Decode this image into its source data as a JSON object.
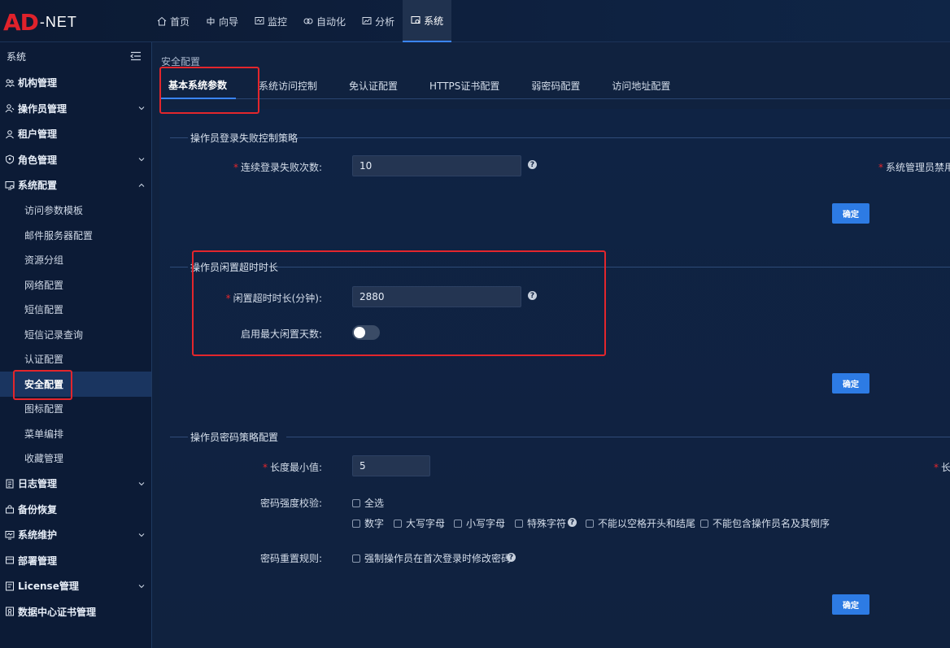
{
  "logo": {
    "mark": "AD",
    "text": "-NET"
  },
  "topnav": [
    {
      "label": "首页",
      "icon": "home-icon"
    },
    {
      "label": "向导",
      "icon": "guide-icon"
    },
    {
      "label": "监控",
      "icon": "monitor-icon"
    },
    {
      "label": "自动化",
      "icon": "automation-icon"
    },
    {
      "label": "分析",
      "icon": "analysis-icon"
    },
    {
      "label": "系统",
      "icon": "system-icon",
      "active": true
    }
  ],
  "sidebar": {
    "title": "系统",
    "items": [
      {
        "label": "机构管理",
        "icon": "organization-icon",
        "expandable": false
      },
      {
        "label": "操作员管理",
        "icon": "operator-icon",
        "expandable": true
      },
      {
        "label": "租户管理",
        "icon": "tenant-icon",
        "expandable": false
      },
      {
        "label": "角色管理",
        "icon": "role-icon",
        "expandable": true
      },
      {
        "label": "系统配置",
        "icon": "system-config-icon",
        "expandable": true,
        "expanded": true,
        "children": [
          "访问参数模板",
          "邮件服务器配置",
          "资源分组",
          "网络配置",
          "短信配置",
          "短信记录查询",
          "认证配置",
          "安全配置",
          "图标配置",
          "菜单编排",
          "收藏管理"
        ],
        "active_child": "安全配置"
      },
      {
        "label": "日志管理",
        "icon": "log-icon",
        "expandable": true
      },
      {
        "label": "备份恢复",
        "icon": "backup-icon",
        "expandable": false
      },
      {
        "label": "系统维护",
        "icon": "maintenance-icon",
        "expandable": true
      },
      {
        "label": "部署管理",
        "icon": "deploy-icon",
        "expandable": false
      },
      {
        "label": "License管理",
        "icon": "license-icon",
        "expandable": true
      },
      {
        "label": "数据中心证书管理",
        "icon": "certificate-icon",
        "expandable": false
      }
    ]
  },
  "main": {
    "breadcrumb": "安全配置",
    "tabs": [
      "基本系统参数",
      "系统访问控制",
      "免认证配置",
      "HTTPS证书配置",
      "弱密码配置",
      "访问地址配置"
    ],
    "active_tab": "基本系统参数",
    "section_login": {
      "legend": "操作员登录失败控制策略",
      "fail_count_label": "连续登录失败次数:",
      "fail_count_value": "10",
      "right_label_partial": "系统管理员禁用",
      "confirm": "确定"
    },
    "section_idle": {
      "legend": "操作员闲置超时时长",
      "timeout_label": "闲置超时时长(分钟):",
      "timeout_value": "2880",
      "max_idle_label": "启用最大闲置天数:",
      "max_idle_enabled": false,
      "confirm": "确定"
    },
    "section_password": {
      "legend": "操作员密码策略配置",
      "min_length_label": "长度最小值:",
      "min_length_value": "5",
      "right_label_partial": "长",
      "strength_label": "密码强度校验:",
      "select_all": "全选",
      "options": [
        "数字",
        "大写字母",
        "小写字母",
        "特殊字符",
        "不能以空格开头和结尾",
        "不能包含操作员名及其倒序"
      ],
      "reset_label": "密码重置规则:",
      "reset_option": "强制操作员在首次登录时修改密码",
      "confirm": "确定"
    }
  },
  "colors": {
    "accent": "#3a85ff",
    "button": "#2d7be4",
    "highlight": "#e3262c",
    "brand": "#e0222b"
  }
}
